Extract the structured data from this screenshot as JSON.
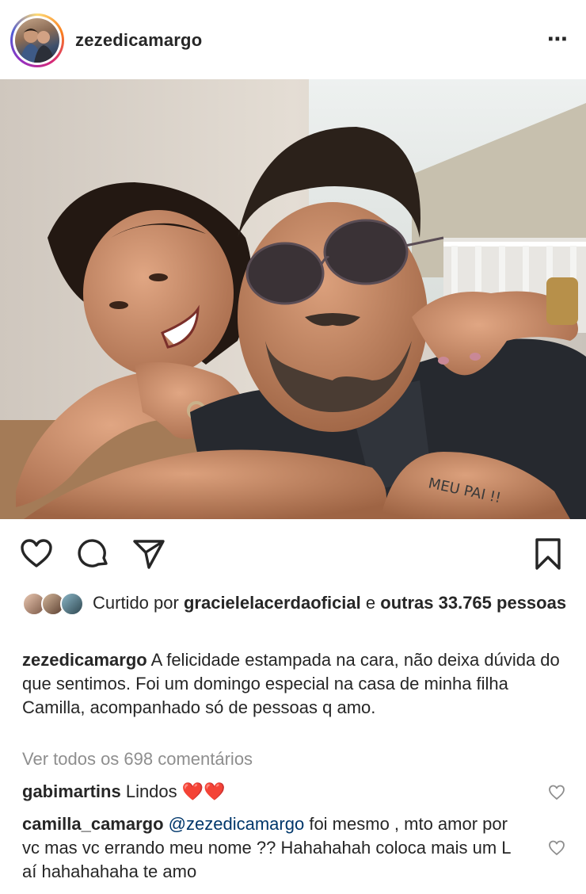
{
  "post": {
    "username": "zezedicamargo",
    "more_icon": "⋯"
  },
  "actions": {
    "like_icon": "heart-icon",
    "comment_icon": "comment-icon",
    "share_icon": "send-icon",
    "save_icon": "bookmark-icon"
  },
  "likes": {
    "prefix": "Curtido por",
    "user": "gracielelacerdaoficial",
    "connector": "e",
    "others": "outras 33.765 pessoas"
  },
  "caption": {
    "username": "zezedicamargo",
    "text": "A felicidade estampada na cara, não deixa dúvida do que sentimos. Foi um domingo especial na casa de minha filha Camilla, acompanhado só de pessoas q amo."
  },
  "view_all": "Ver todos os 698 comentários",
  "comments": [
    {
      "username": "gabimartins",
      "text": "Lindos ❤️❤️"
    },
    {
      "username": "camilla_camargo",
      "mention": "@zezedicamargo",
      "text": "foi mesmo , mto amor por vc mas vc errando meu nome ?? Hahahahah coloca mais um L aí hahahahaha te amo"
    }
  ]
}
